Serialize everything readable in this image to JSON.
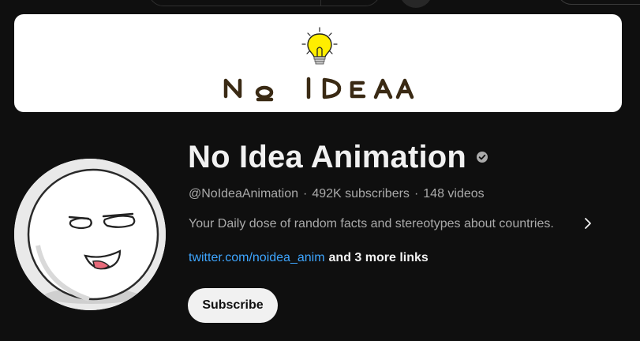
{
  "banner": {
    "logo_text": "NO IDEA"
  },
  "channel": {
    "name": "No Idea Animation",
    "handle": "@NoIdeaAnimation",
    "subscribers": "492K subscribers",
    "videos": "148 videos",
    "separator": "·",
    "description": "Your Daily dose of random facts and stereotypes about countries.",
    "link_text": "twitter.com/noidea_anim",
    "more_links": "and 3 more links"
  },
  "actions": {
    "subscribe_label": "Subscribe"
  },
  "icons": {
    "verified": "verified-check-icon",
    "description_expand": "chevron-right-icon"
  },
  "colors": {
    "background": "#0f0f0f",
    "link": "#3ea6ff",
    "secondary_text": "#aaaaaa",
    "subscribe_bg": "#f1f1f1"
  }
}
